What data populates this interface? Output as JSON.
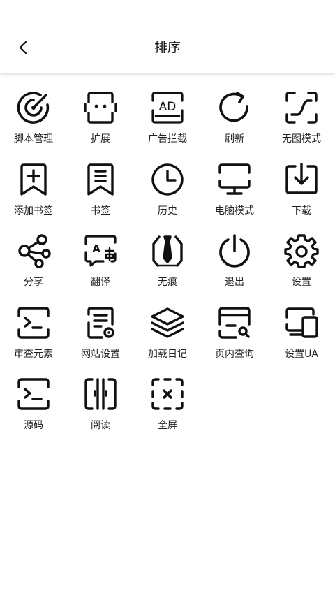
{
  "header": {
    "title": "排序",
    "back_icon": "back-arrow-icon"
  },
  "items": [
    {
      "label": "脚本管理",
      "icon": "script-target-icon"
    },
    {
      "label": "扩展",
      "icon": "robot-extension-icon"
    },
    {
      "label": "广告拦截",
      "icon": "ad-block-icon"
    },
    {
      "label": "刷新",
      "icon": "refresh-icon"
    },
    {
      "label": "无图模式",
      "icon": "no-image-icon"
    },
    {
      "label": "添加书签",
      "icon": "add-bookmark-icon"
    },
    {
      "label": "书签",
      "icon": "bookmark-icon"
    },
    {
      "label": "历史",
      "icon": "clock-history-icon"
    },
    {
      "label": "电脑模式",
      "icon": "desktop-icon"
    },
    {
      "label": "下载",
      "icon": "download-icon"
    },
    {
      "label": "分享",
      "icon": "share-icon"
    },
    {
      "label": "翻译",
      "icon": "translate-icon"
    },
    {
      "label": "无痕",
      "icon": "incognito-icon"
    },
    {
      "label": "退出",
      "icon": "power-icon"
    },
    {
      "label": "设置",
      "icon": "gear-icon"
    },
    {
      "label": "审查元素",
      "icon": "terminal-icon"
    },
    {
      "label": "网站设置",
      "icon": "site-settings-icon"
    },
    {
      "label": "加载日记",
      "icon": "layers-icon"
    },
    {
      "label": "页内查询",
      "icon": "page-search-icon"
    },
    {
      "label": "设置UA",
      "icon": "devices-icon"
    },
    {
      "label": "源码",
      "icon": "source-code-icon"
    },
    {
      "label": "阅读",
      "icon": "reader-icon"
    },
    {
      "label": "全屏",
      "icon": "fullscreen-icon"
    }
  ]
}
